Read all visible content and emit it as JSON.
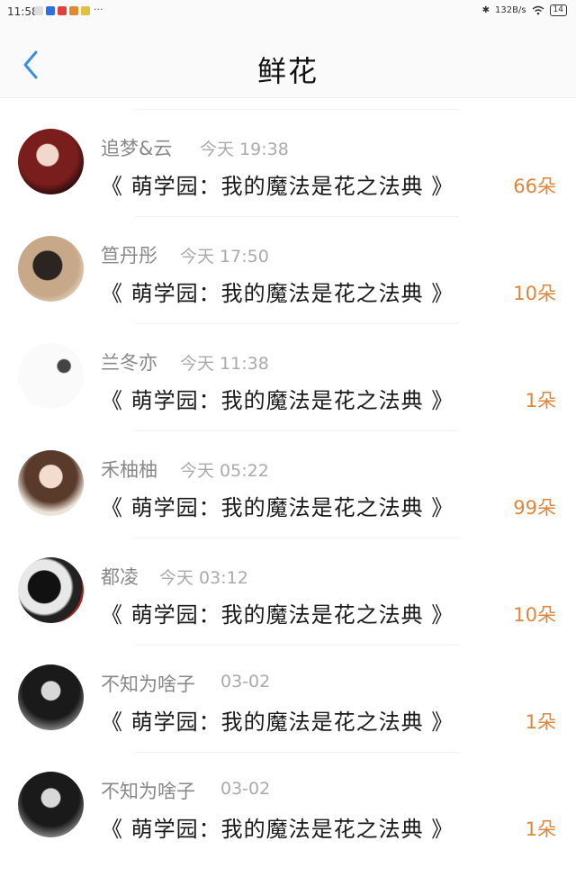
{
  "status": {
    "time": "11:58",
    "dots": "···",
    "net_speed": "132B/s",
    "battery": "14"
  },
  "header": {
    "title": "鲜花"
  },
  "items": [
    {
      "name": "追梦&云",
      "time": "今天 19:38",
      "book": "《 萌学园：我的魔法是花之法典 》",
      "count": "66朵",
      "avatar_color": "#6b1a1a"
    },
    {
      "name": "笪丹彤",
      "time": "今天 17:50",
      "book": "《 萌学园：我的魔法是花之法典 》",
      "count": "10朵",
      "avatar_color": "#8a6a4a"
    },
    {
      "name": "兰冬亦",
      "time": "今天 11:38",
      "book": "《 萌学园：我的魔法是花之法典 》",
      "count": "1朵",
      "avatar_color": "#d9d6d0"
    },
    {
      "name": "禾柚柚",
      "time": "今天 05:22",
      "book": "《 萌学园：我的魔法是花之法典 》",
      "count": "99朵",
      "avatar_color": "#c9a88a"
    },
    {
      "name": "都凌",
      "time": "今天 03:12",
      "book": "《 萌学园：我的魔法是花之法典 》",
      "count": "10朵",
      "avatar_color": "#3a3a3a"
    },
    {
      "name": "不知为啥子",
      "time": "03-02",
      "book": "《 萌学园：我的魔法是花之法典 》",
      "count": "1朵",
      "avatar_color": "#2b2b2b"
    },
    {
      "name": "不知为啥子",
      "time": "03-02",
      "book": "《 萌学园：我的魔法是花之法典 》",
      "count": "1朵",
      "avatar_color": "#2b2b2b"
    }
  ]
}
